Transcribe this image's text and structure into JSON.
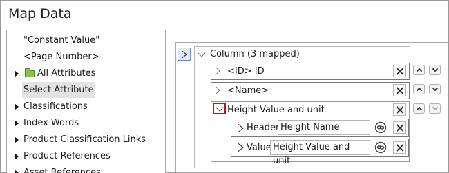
{
  "window": {
    "title": "Map Data"
  },
  "tree": {
    "items": [
      {
        "label": "\"Constant Value\"",
        "expandable": false,
        "folder": false,
        "selected": false
      },
      {
        "label": "<Page Number>",
        "expandable": false,
        "folder": false,
        "selected": false
      },
      {
        "label": "All Attributes",
        "expandable": true,
        "folder": true,
        "selected": false
      },
      {
        "label": "Select Attribute",
        "expandable": false,
        "folder": false,
        "selected": true
      },
      {
        "label": "Classifications",
        "expandable": true,
        "folder": false,
        "selected": false
      },
      {
        "label": "Index Words",
        "expandable": true,
        "folder": false,
        "selected": false
      },
      {
        "label": "Product Classification Links",
        "expandable": true,
        "folder": false,
        "selected": false
      },
      {
        "label": "Product References",
        "expandable": true,
        "folder": false,
        "selected": false
      },
      {
        "label": "Asset References",
        "expandable": true,
        "folder": false,
        "selected": false
      }
    ]
  },
  "mapping": {
    "column_label": "Column (3 mapped)",
    "fields": [
      {
        "label": "<ID> ID"
      },
      {
        "label": "<Name>"
      },
      {
        "label": "Height Value and unit"
      }
    ],
    "expanded": {
      "header_label": "Header",
      "header_value": "Height Name",
      "value_label": "Value",
      "value_value": "Height Value and unit"
    }
  },
  "colors": {
    "accent_highlight": "#a61b22",
    "toggle_border": "#5a8fd0",
    "folder": "#8bc34a"
  }
}
